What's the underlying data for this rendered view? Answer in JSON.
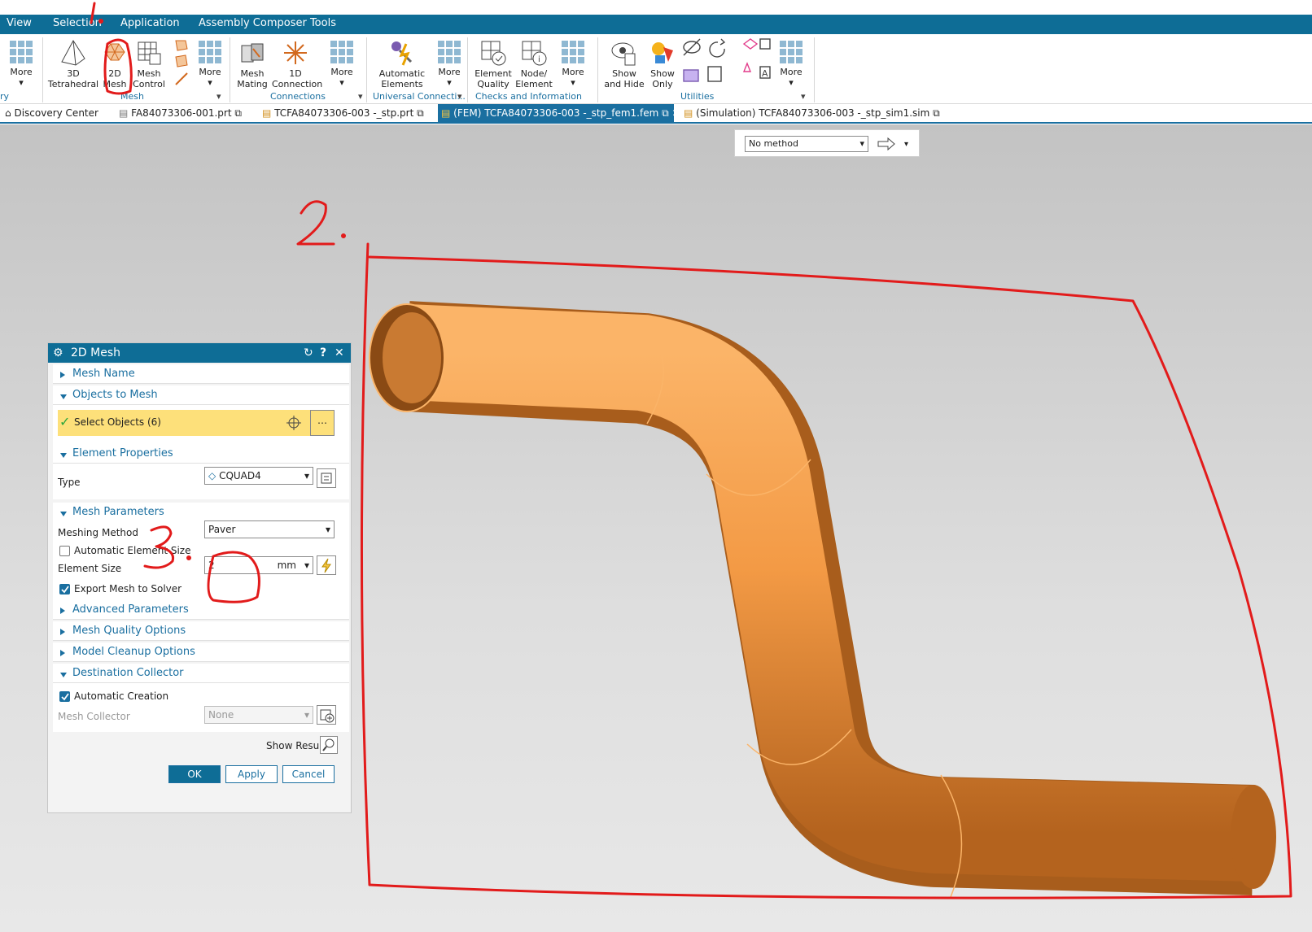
{
  "menu": {
    "items": [
      "View",
      "Selection",
      "Application",
      "Assembly Composer Tools"
    ]
  },
  "ribbon": {
    "more_left": "More",
    "prev_group_tail": "ry",
    "mesh_group": {
      "label": "Mesh",
      "tetra_line1": "3D",
      "tetra_line2": "Tetrahedral",
      "mesh2d_line1": "2D",
      "mesh2d_line2": "Mesh",
      "control_line1": "Mesh",
      "control_line2": "Control",
      "more": "More"
    },
    "connections_group": {
      "label": "Connections",
      "mating_line1": "Mesh",
      "mating_line2": "Mating",
      "conn1d_line1": "1D",
      "conn1d_line2": "Connection",
      "more": "More"
    },
    "universal_group": {
      "label": "Universal Connecti...",
      "auto_line1": "Automatic",
      "auto_line2": "Elements",
      "more": "More"
    },
    "checks_group": {
      "label": "Checks and Information",
      "quality_line1": "Element",
      "quality_line2": "Quality",
      "node_line1": "Node/",
      "node_line2": "Element",
      "more": "More"
    },
    "utilities_group": {
      "label": "Utilities",
      "showhide_line1": "Show",
      "showhide_line2": "and Hide",
      "showonly_line1": "Show",
      "showonly_line2": "Only",
      "more": "More"
    }
  },
  "tabs": [
    {
      "label": "Discovery Center"
    },
    {
      "label": "FA84073306-001.prt"
    },
    {
      "label": "TCFA84073306-003 -_stp.prt"
    },
    {
      "label": "(FEM) TCFA84073306-003 -_stp_fem1.fem"
    },
    {
      "label": "(Simulation) TCFA84073306-003 -_stp_sim1.sim"
    }
  ],
  "selection_bar": {
    "method": "No method"
  },
  "dialog": {
    "title": "2D Mesh",
    "sections": {
      "mesh_name": "Mesh Name",
      "objects_to_mesh": "Objects to Mesh",
      "element_properties": "Element Properties",
      "mesh_parameters": "Mesh Parameters",
      "advanced_parameters": "Advanced Parameters",
      "mesh_quality_options": "Mesh Quality Options",
      "model_cleanup_options": "Model Cleanup Options",
      "destination_collector": "Destination Collector"
    },
    "select_objects": "Select Objects (6)",
    "type_label": "Type",
    "type_value": "CQUAD4",
    "meshing_method_label": "Meshing Method",
    "meshing_method_value": "Paver",
    "auto_element_size_label": "Automatic Element Size",
    "auto_element_size_checked": false,
    "element_size_label": "Element Size",
    "element_size_value": "2",
    "element_size_unit": "mm",
    "export_mesh_label": "Export Mesh to Solver",
    "export_mesh_checked": true,
    "automatic_creation_label": "Automatic Creation",
    "automatic_creation_checked": true,
    "mesh_collector_label": "Mesh Collector",
    "mesh_collector_value": "None",
    "show_result": "Show Result",
    "ok": "OK",
    "apply": "Apply",
    "cancel": "Cancel"
  },
  "colors": {
    "accent": "#0e6d96",
    "pipe": "#f39a45",
    "annotation": "#e21b1b",
    "highlight_row": "#fde07a"
  },
  "icons": [
    "more-grid-icon",
    "tetrahedral-icon",
    "mesh-2d-icon",
    "mesh-control-icon",
    "mesh-mating-icon",
    "connection-1d-icon",
    "automatic-elements-icon",
    "element-quality-icon",
    "node-element-icon",
    "show-and-hide-icon",
    "show-only-icon",
    "settings-gear-icon",
    "reset-icon",
    "help-icon",
    "close-icon",
    "crosshair-icon",
    "ellipsis-icon",
    "lightning-icon",
    "search-icon"
  ]
}
